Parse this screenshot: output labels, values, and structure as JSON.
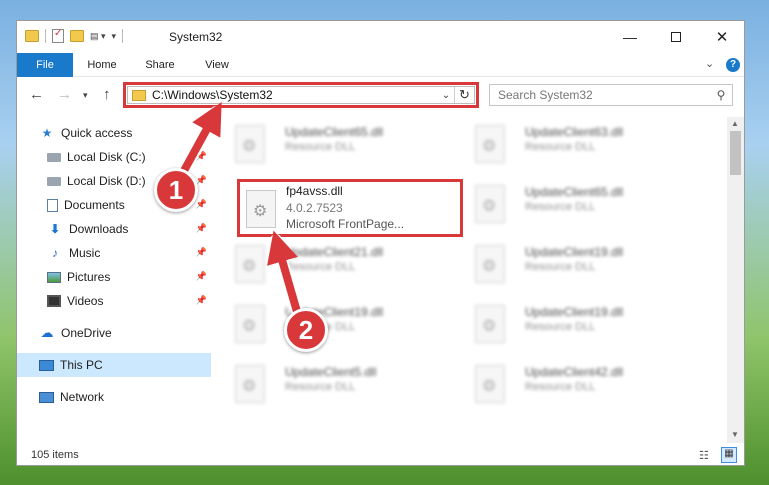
{
  "window": {
    "title": "System32",
    "min_glyph": "—",
    "close_glyph": "✕"
  },
  "ribbon": {
    "tabs": [
      "File",
      "Home",
      "Share",
      "View"
    ],
    "chevron": "⌄",
    "help": "?"
  },
  "nav": {
    "back": "←",
    "forward": "→",
    "recent": "▾",
    "up": "↑"
  },
  "address": {
    "path": "C:\\Windows\\System32",
    "dropdown": "⌄",
    "refresh": "↻"
  },
  "search": {
    "placeholder": "Search System32",
    "icon": "⚲"
  },
  "sidebar": {
    "items": [
      {
        "label": "Quick access",
        "icon": "star-icon",
        "glyph": "★"
      },
      {
        "label": "Local Disk (C:)",
        "icon": "disk-icon",
        "pinned": true
      },
      {
        "label": "Local Disk (D:)",
        "icon": "disk-icon",
        "pinned": true
      },
      {
        "label": "Documents",
        "icon": "document-icon",
        "pinned": true
      },
      {
        "label": "Downloads",
        "icon": "download-icon",
        "glyph": "⬇",
        "pinned": true
      },
      {
        "label": "Music",
        "icon": "music-icon",
        "glyph": "♪",
        "pinned": true
      },
      {
        "label": "Pictures",
        "icon": "pictures-icon",
        "pinned": true
      },
      {
        "label": "Videos",
        "icon": "videos-icon",
        "pinned": true
      },
      {
        "label": "OneDrive",
        "icon": "cloud-icon",
        "glyph": "☁"
      },
      {
        "label": "This PC",
        "icon": "pc-icon",
        "selected": true
      },
      {
        "label": "Network",
        "icon": "network-icon"
      }
    ],
    "pin_glyph": "📌"
  },
  "files": {
    "highlighted": {
      "name": "fp4avss.dll",
      "version": "4.0.2.7523",
      "description": "Microsoft FrontPage..."
    },
    "left_column": [
      {
        "name": "UpdateClient65.dll",
        "type": "Resource DLL"
      },
      {
        "name": "UpdateClient21.dll",
        "type": "Resource DLL"
      },
      {
        "name": "UpdateClient19.dll",
        "type": "Resource DLL"
      },
      {
        "name": "UpdateClient5.dll",
        "type": "Resource DLL"
      }
    ],
    "right_column": [
      {
        "name": "UpdateClient63.dll",
        "type": "Resource DLL"
      },
      {
        "name": "UpdateClient65.dll",
        "type": "Resource DLL"
      },
      {
        "name": "UpdateClient19.dll",
        "type": "Resource DLL"
      },
      {
        "name": "UpdateClient19.dll",
        "type": "Resource DLL"
      },
      {
        "name": "UpdateClient42.dll",
        "type": "Resource DLL"
      }
    ]
  },
  "status": {
    "item_count": "105 items"
  },
  "annotations": {
    "step1": "1",
    "step2": "2",
    "color": "#d9383a"
  }
}
